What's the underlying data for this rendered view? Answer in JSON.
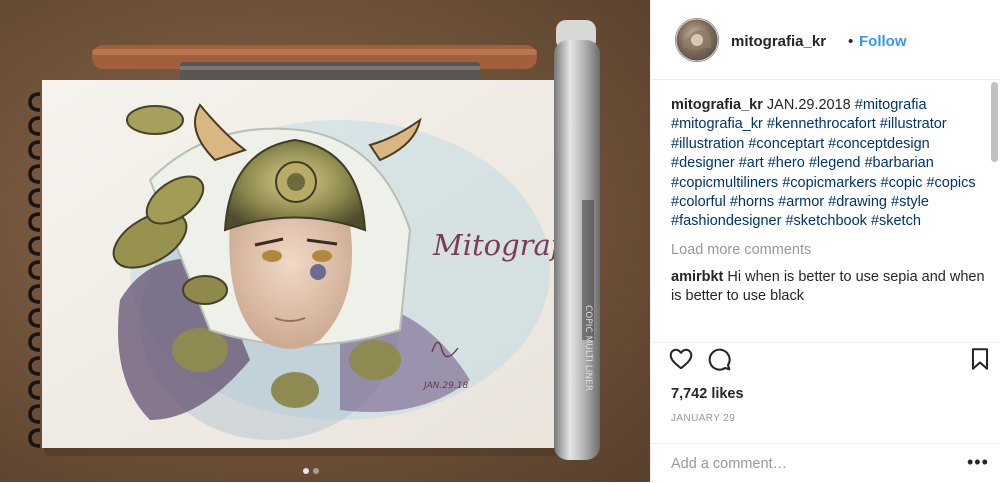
{
  "post": {
    "media": {
      "artwork_signature": "Mitografia",
      "drawing_date": "JAN.29.18",
      "pen_brand": "COPIC MULTI LINER",
      "carousel": {
        "count": 2,
        "active": 0
      }
    },
    "header": {
      "username": "mitografia_kr",
      "separator": "•",
      "follow_label": "Follow",
      "avatar_icon": "avatar-image"
    },
    "caption": {
      "username": "mitografia_kr",
      "text": "JAN.29.2018",
      "hashtags": "#mitografia #mitografia_kr #kennethrocafort #illustrator #illustration #conceptart #conceptdesign #designer #art #hero #legend #barbarian #copicmultiliners #copicmarkers #copic #copics #colorful #horns #armor #drawing #style #fashiondesigner #sketchbook #sketch"
    },
    "load_more_label": "Load more comments",
    "comments": [
      {
        "username": "amirbkt",
        "text": "Hi when is better to use sepia and when is better to use black"
      }
    ],
    "actions": {
      "like_icon": "heart-icon",
      "comment_icon": "comment-bubble-icon",
      "save_icon": "bookmark-icon"
    },
    "likes_label": "7,742 likes",
    "date_label": "JANUARY 29",
    "add_comment": {
      "placeholder": "Add a comment…",
      "more_label": "•••"
    },
    "colors": {
      "link": "#003569",
      "follow": "#3897f0",
      "muted": "#999999",
      "text": "#262626"
    }
  }
}
